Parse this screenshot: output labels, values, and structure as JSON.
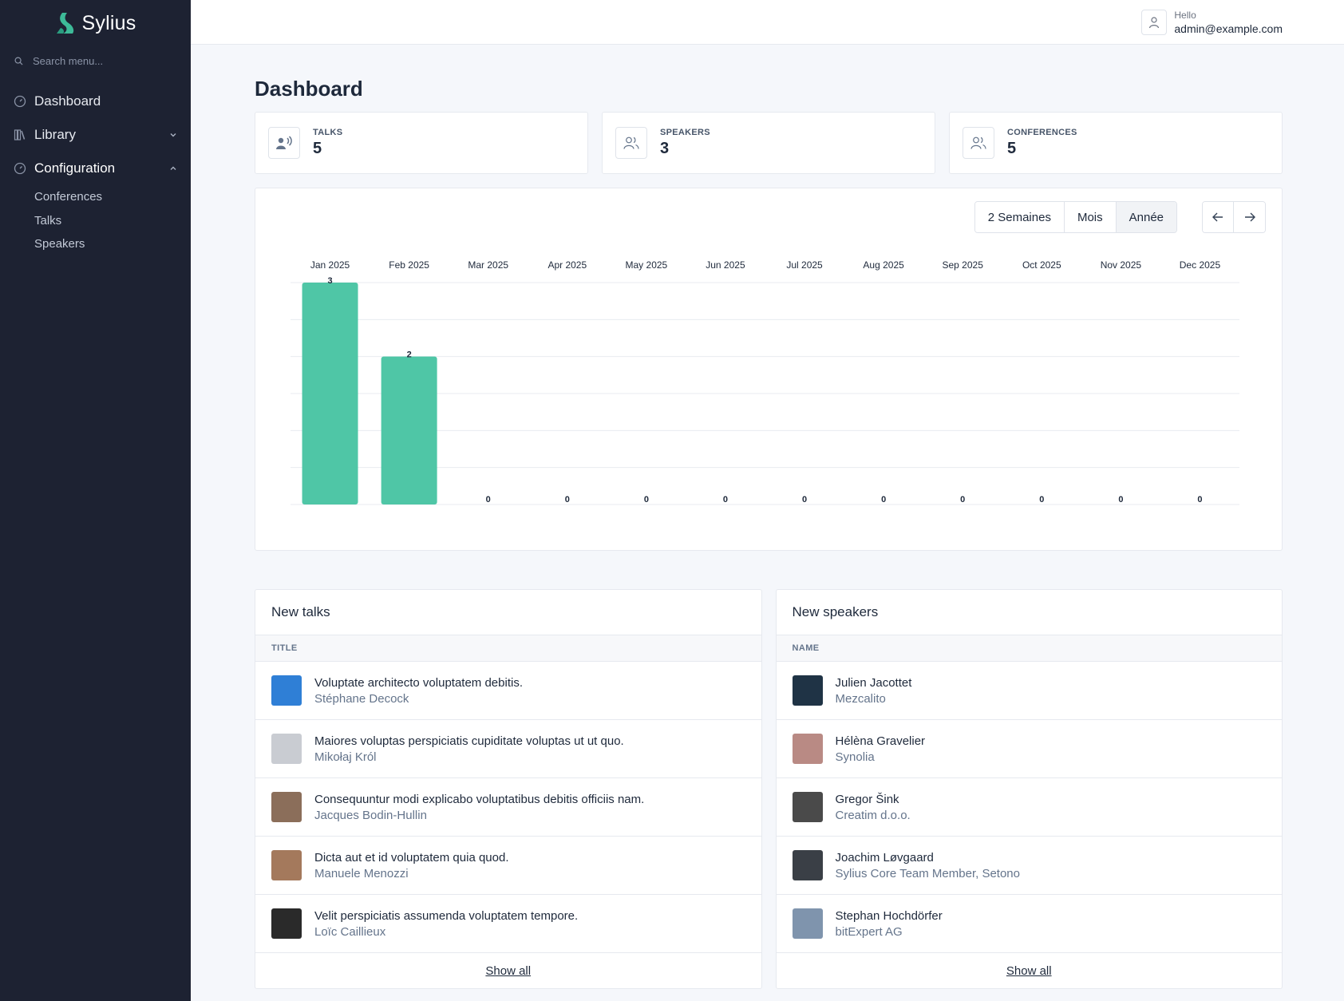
{
  "app": {
    "logo_text": "Sylius",
    "brand_color": "#3dba98"
  },
  "sidebar": {
    "search_placeholder": "Search menu...",
    "items": [
      {
        "label": "Dashboard",
        "icon": "dashboard-icon"
      },
      {
        "label": "Library",
        "icon": "library-icon",
        "expanded": false
      },
      {
        "label": "Configuration",
        "icon": "configuration-icon",
        "expanded": true
      }
    ],
    "subitems": [
      "Conferences",
      "Talks",
      "Speakers"
    ]
  },
  "header": {
    "hello": "Hello",
    "email": "admin@example.com"
  },
  "page": {
    "title": "Dashboard"
  },
  "stats": [
    {
      "label": "TALKS",
      "value": "5",
      "icon": "talks-icon"
    },
    {
      "label": "SPEAKERS",
      "value": "3",
      "icon": "speakers-icon"
    },
    {
      "label": "CONFERENCES",
      "value": "5",
      "icon": "conferences-icon"
    }
  ],
  "chart_controls": {
    "ranges": [
      "2 Semaines",
      "Mois",
      "Année"
    ],
    "selected": "Année"
  },
  "chart_data": {
    "type": "bar",
    "categories": [
      "Jan 2025",
      "Feb 2025",
      "Mar 2025",
      "Apr 2025",
      "May 2025",
      "Jun 2025",
      "Jul 2025",
      "Aug 2025",
      "Sep 2025",
      "Oct 2025",
      "Nov 2025",
      "Dec 2025"
    ],
    "values": [
      3,
      2,
      0,
      0,
      0,
      0,
      0,
      0,
      0,
      0,
      0,
      0
    ],
    "ylim": [
      0,
      3
    ],
    "bar_color": "#4fc6a6",
    "grid": true,
    "xaxis_position": "top"
  },
  "new_talks": {
    "title": "New talks",
    "column": "TITLE",
    "rows": [
      {
        "title": "Voluptate architecto voluptatem debitis.",
        "subtitle": "Stéphane Decock",
        "avatar_color": "#2f7fd6"
      },
      {
        "title": "Maiores voluptas perspiciatis cupiditate voluptas ut ut quo.",
        "subtitle": "Mikołaj Król",
        "avatar_color": "#c9ccd2"
      },
      {
        "title": "Consequuntur modi explicabo voluptatibus debitis officiis nam.",
        "subtitle": "Jacques Bodin-Hullin",
        "avatar_color": "#8b6e5a"
      },
      {
        "title": "Dicta aut et id voluptatem quia quod.",
        "subtitle": "Manuele Menozzi",
        "avatar_color": "#a4795c"
      },
      {
        "title": "Velit perspiciatis assumenda voluptatem tempore.",
        "subtitle": "Loïc Caillieux",
        "avatar_color": "#2a2a2a"
      }
    ],
    "show_all": "Show all"
  },
  "new_speakers": {
    "title": "New speakers",
    "column": "NAME",
    "rows": [
      {
        "title": "Julien Jacottet",
        "subtitle": "Mezcalito",
        "avatar_color": "#1f3345"
      },
      {
        "title": "Hélèna Gravelier",
        "subtitle": "Synolia",
        "avatar_color": "#b98a84"
      },
      {
        "title": "Gregor Šink",
        "subtitle": "Creatim d.o.o.",
        "avatar_color": "#4a4a4a"
      },
      {
        "title": "Joachim Løvgaard",
        "subtitle": "Sylius Core Team Member, Setono",
        "avatar_color": "#3a3f46"
      },
      {
        "title": "Stephan Hochdörfer",
        "subtitle": "bitExpert AG",
        "avatar_color": "#7f94ad"
      }
    ],
    "show_all": "Show all"
  }
}
